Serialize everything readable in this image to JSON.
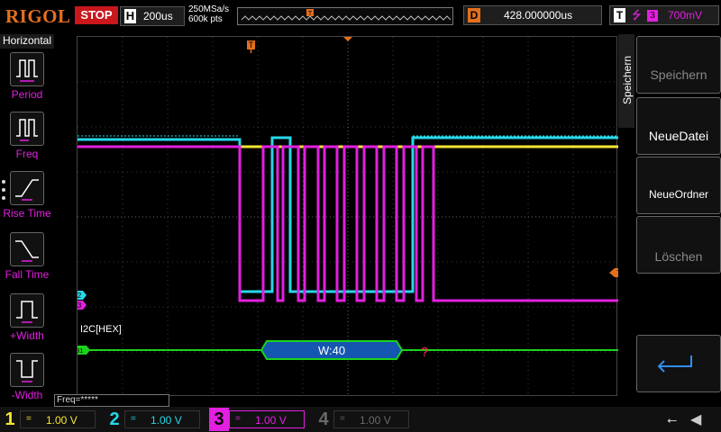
{
  "header": {
    "brand": "RIGOL",
    "run_state": "STOP",
    "horizontal_label": "H",
    "timebase": "200us",
    "sample_rate": "250MSa/s",
    "memory_depth": "600k pts",
    "trigger_position_marker": "T",
    "delay_label": "D",
    "delay_value": "428.000000us",
    "trigger_label": "T",
    "trigger_source": "3",
    "trigger_level": "700mV"
  },
  "left_menu": {
    "title": "Horizontal",
    "items": [
      {
        "label": "Period",
        "icon": "period-icon"
      },
      {
        "label": "Freq",
        "icon": "freq-icon"
      },
      {
        "label": "Rise Time",
        "icon": "rise-time-icon"
      },
      {
        "label": "Fall Time",
        "icon": "fall-time-icon"
      },
      {
        "label": "+Width",
        "icon": "positive-width-icon"
      },
      {
        "label": "-Width",
        "icon": "negative-width-icon"
      }
    ]
  },
  "right_menu": {
    "title": "Speichern",
    "buttons": [
      {
        "label": "Speichern",
        "enabled": false
      },
      {
        "label": "NeueDatei",
        "enabled": true
      },
      {
        "label": "NeueOrdner",
        "enabled": true
      },
      {
        "label": "Löschen",
        "enabled": false
      },
      {
        "label": "",
        "icon": "return-arrow-icon",
        "enabled": true
      }
    ]
  },
  "waveform": {
    "channel_markers": [
      "2",
      "3"
    ],
    "bus_marker": "B1",
    "trigger_level_marker": "T",
    "decode_title": "I2C[HEX]",
    "decode_packet": "W:40",
    "decode_unknown": "?",
    "freq_readout": "Freq=*****"
  },
  "channels": [
    {
      "num": "1",
      "coupling": "=",
      "scale": "1.00 V",
      "color": "#f5e634",
      "active": false
    },
    {
      "num": "2",
      "coupling": "=",
      "scale": "1.00 V",
      "color": "#26d8e8",
      "active": false
    },
    {
      "num": "3",
      "coupling": "=",
      "scale": "1.00 V",
      "color": "#e31fe0",
      "active": true
    },
    {
      "num": "4",
      "coupling": "=",
      "scale": "1.00 V",
      "color": "#6a6a6a",
      "active": false
    }
  ],
  "status": {
    "usb_icon": "usb-icon",
    "sound_icon": "speaker-mute-icon"
  },
  "colors": {
    "ch1": "#f5e634",
    "ch2": "#26d8e8",
    "ch3": "#e31fe0",
    "bus": "#1bd31b",
    "accent": "#e36f1e",
    "stop": "#c9171c"
  }
}
